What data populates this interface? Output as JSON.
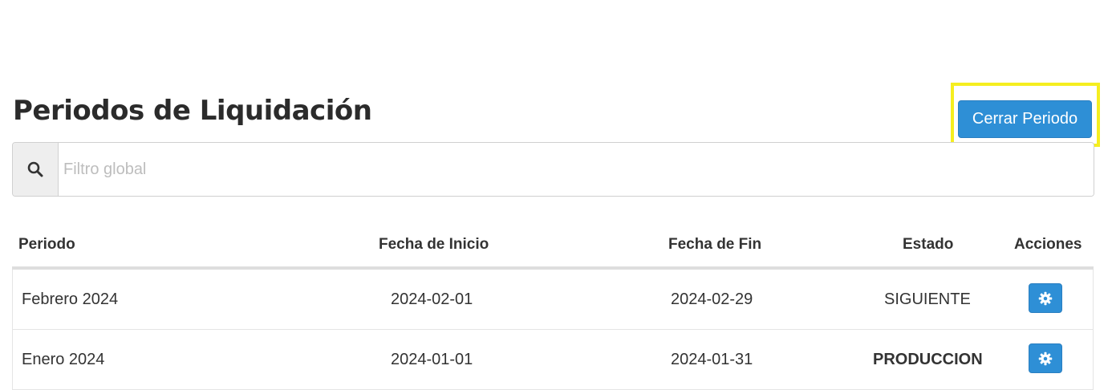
{
  "page": {
    "title": "Periodos de Liquidación",
    "close_button_label": "Cerrar Periodo"
  },
  "search": {
    "placeholder": "Filtro global",
    "value": "",
    "icon": "search-icon"
  },
  "table": {
    "headers": {
      "period": "Periodo",
      "start_date": "Fecha de Inicio",
      "end_date": "Fecha de Fin",
      "status": "Estado",
      "actions": "Acciones"
    },
    "rows": [
      {
        "period": "Febrero 2024",
        "start_date": "2024-02-01",
        "end_date": "2024-02-29",
        "status": "SIGUIENTE",
        "status_bold": false,
        "action_icon": "gear-icon"
      },
      {
        "period": "Enero 2024",
        "start_date": "2024-01-01",
        "end_date": "2024-01-31",
        "status": "PRODUCCION",
        "status_bold": true,
        "action_icon": "gear-icon"
      }
    ]
  },
  "colors": {
    "primary": "#2e8fd6",
    "highlight": "#f5ee1f"
  }
}
